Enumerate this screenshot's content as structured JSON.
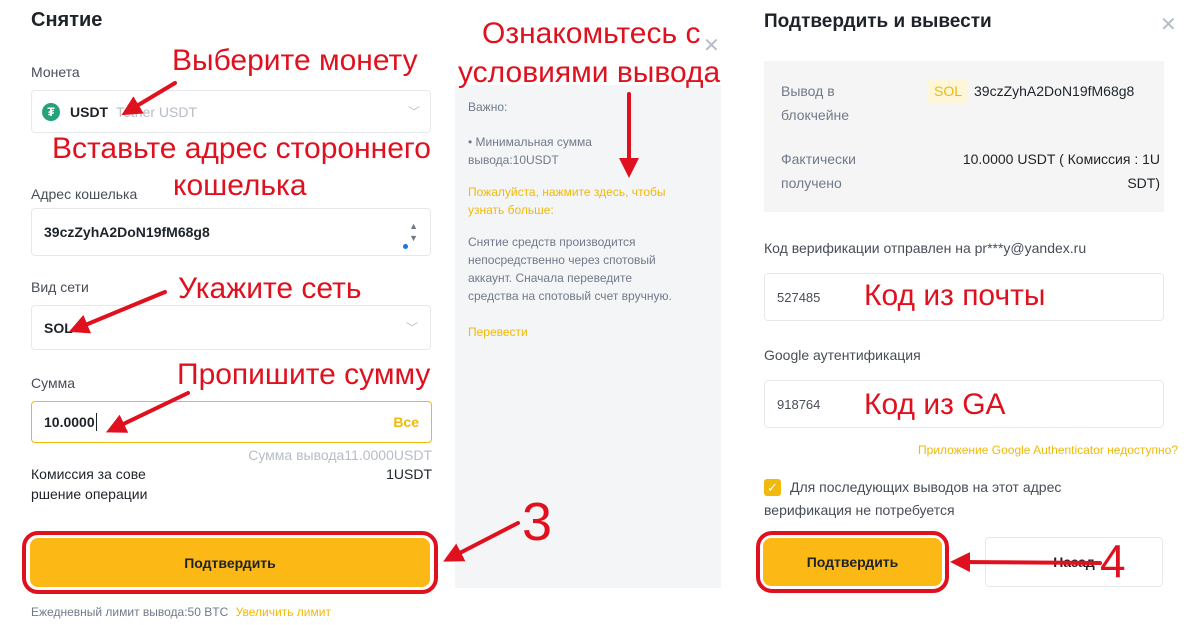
{
  "left": {
    "title": "Снятие",
    "coin_label": "Монета",
    "coin_symbol": "USDT",
    "coin_icon_glyph": "₮",
    "coin_name": "Tether USDT",
    "address_label": "Адрес кошелька",
    "address_value": "39czZyhA2DoN19fM68g8",
    "network_label": "Вид сети",
    "network_value": "SOL",
    "amount_label": "Сумма",
    "amount_value": "10.0000",
    "amount_all": "Все",
    "withdraw_sum": "Сумма вывода11.0000USDT",
    "fee_label_1": "Комиссия за сове",
    "fee_label_2": "ршение операции",
    "fee_value": "1USDT",
    "confirm": "Подтвердить",
    "limit_text": "Ежедневный лимит вывода:50 BTC",
    "limit_link": "Увеличить лимит"
  },
  "middle": {
    "important": "Важно:",
    "min_1": "• Минимальная сумма",
    "min_2": "вывода:10USDT",
    "link_1": "Пожалуйста, нажмите здесь, чтобы",
    "link_2": "узнать больше:",
    "info_1": "Снятие средств производится",
    "info_2": "непосредственно через спотовый",
    "info_3": "аккаунт. Сначала переведите",
    "info_4": "средства на спотовый счет вручную.",
    "transfer": "Перевести"
  },
  "right": {
    "title": "Подтвердить и вывести",
    "chain_label_1": "Вывод в",
    "chain_label_2": "блокчейне",
    "chain_badge": "SOL",
    "chain_address": "39czZyhA2DoN19fM68g8",
    "received_label_1": "Фактически",
    "received_label_2": "получено",
    "received_value_1": "10.0000 USDT ( Комиссия : 1U",
    "received_value_2": "SDT)",
    "email_note": "Код верификации отправлен на pr***y@yandex.ru",
    "email_code": "527485",
    "ga_label": "Google аутентификация",
    "ga_code": "918764",
    "ga_unavailable": "Приложение Google Authenticator недоступно?",
    "check_1": "Для последующих выводов на этот адрес",
    "check_2": "верификация не потребуется",
    "confirm": "Подтвердить",
    "back": "Назад"
  },
  "annotations": {
    "choose_coin": "Выберите монету",
    "paste_1": "Вставьте адрес стороннего",
    "paste_2": "кошелька",
    "network": "Укажите сеть",
    "amount": "Пропишите сумму",
    "read_1": "Ознакомьтесь с",
    "read_2": "условиями вывода",
    "email_code": "Код из почты",
    "ga_code": "Код из GA",
    "step3": "3",
    "step4": "4"
  },
  "colors": {
    "accent_yellow": "#fcb815",
    "annotation_red": "#e0111f",
    "usdt_green": "#26a17b"
  }
}
